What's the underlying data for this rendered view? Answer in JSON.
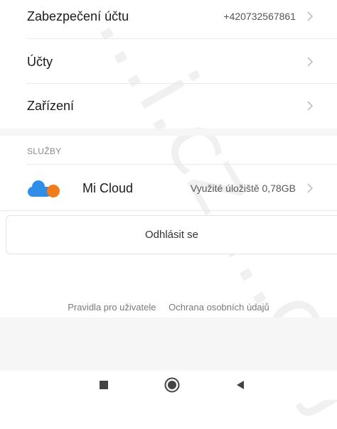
{
  "rows": {
    "security": {
      "title": "Zabezpečení účtu",
      "value": "+420732567861"
    },
    "accounts": {
      "title": "Účty",
      "value": ""
    },
    "devices": {
      "title": "Zařízení",
      "value": ""
    }
  },
  "services": {
    "label": "SLUŽBY",
    "micloud": {
      "title": "Mi Cloud",
      "value": "Využité úložiště 0,78GB"
    }
  },
  "logout_label": "Odhlásit se",
  "links": {
    "terms": "Pravidla pro uživatele",
    "privacy": "Ochrana osobních údajů"
  },
  "watermark": "...i.cz ...caj",
  "icons": {
    "chevron": "chevron-right-icon",
    "cloud": "mi-cloud-icon",
    "nav": [
      "recent-apps-square-icon",
      "home-circle-icon",
      "back-triangle-icon"
    ]
  },
  "colors": {
    "cloud_blue": "#2f8ee8",
    "cloud_orange": "#f27b1a",
    "chevron": "#b8b8b8",
    "nav_icon": "#444444"
  }
}
